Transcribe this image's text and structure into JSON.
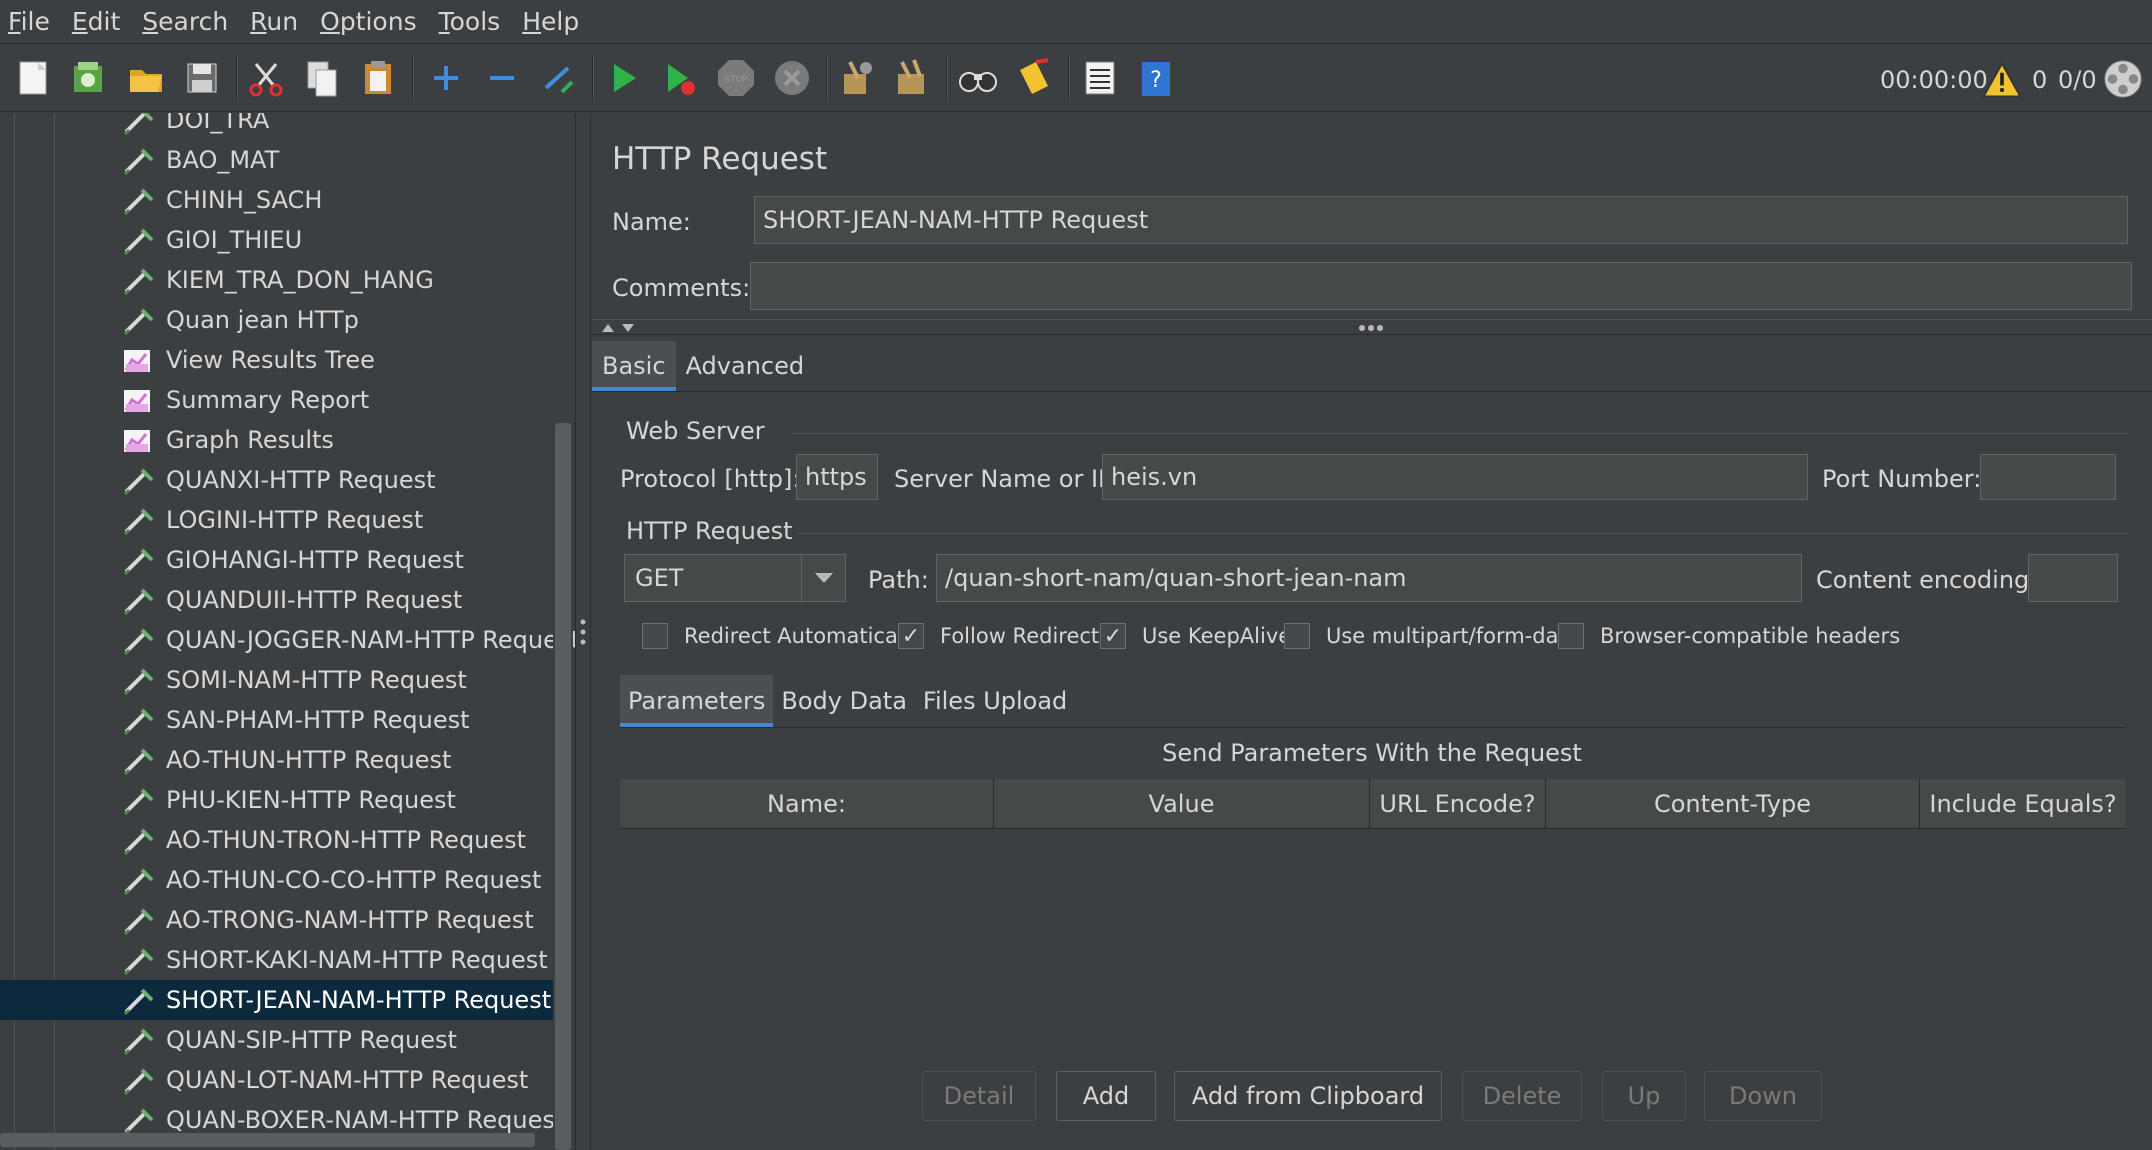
{
  "menu": [
    {
      "label": "File",
      "mnemonic": "F",
      "rest": "ile"
    },
    {
      "label": "Edit",
      "mnemonic": "E",
      "rest": "dit"
    },
    {
      "label": "Search",
      "mnemonic": "S",
      "rest": "earch"
    },
    {
      "label": "Run",
      "mnemonic": "R",
      "rest": "un"
    },
    {
      "label": "Options",
      "mnemonic": "O",
      "rest": "ptions"
    },
    {
      "label": "Tools",
      "mnemonic": "T",
      "rest": "ools"
    },
    {
      "label": "Help",
      "mnemonic": "H",
      "rest": "elp"
    }
  ],
  "toolbar": {
    "icons": [
      "new-icon",
      "templates-icon",
      "open-icon",
      "save-icon",
      "cut-icon",
      "copy-icon",
      "paste-icon",
      "expand-icon",
      "collapse-icon",
      "toggle-icon",
      "start-icon",
      "start-no-pause-icon",
      "stop-icon",
      "shutdown-icon",
      "clear-icon",
      "clear-all-icon",
      "search-icon",
      "reset-search-icon",
      "function-helper-icon",
      "help-icon"
    ],
    "timer": "00:00:00",
    "warning_count": "0",
    "thread_count": "0/0"
  },
  "tree": {
    "items": [
      {
        "label": "DOI_TRA",
        "icon": "sampler-icon"
      },
      {
        "label": "BAO_MAT",
        "icon": "sampler-icon"
      },
      {
        "label": "CHINH_SACH",
        "icon": "sampler-icon"
      },
      {
        "label": "GIOI_THIEU",
        "icon": "sampler-icon"
      },
      {
        "label": "KIEM_TRA_DON_HANG",
        "icon": "sampler-icon"
      },
      {
        "label": "Quan jean HTTp",
        "icon": "sampler-icon"
      },
      {
        "label": "View Results Tree",
        "icon": "listener-icon"
      },
      {
        "label": "Summary Report",
        "icon": "listener-icon"
      },
      {
        "label": "Graph Results",
        "icon": "listener-icon"
      },
      {
        "label": "QUANXI-HTTP Request",
        "icon": "sampler-icon"
      },
      {
        "label": "LOGINI-HTTP Request",
        "icon": "sampler-icon"
      },
      {
        "label": "GIOHANGI-HTTP Request",
        "icon": "sampler-icon"
      },
      {
        "label": "QUANDUII-HTTP Request",
        "icon": "sampler-icon"
      },
      {
        "label": "QUAN-JOGGER-NAM-HTTP Request",
        "icon": "sampler-icon"
      },
      {
        "label": "SOMI-NAM-HTTP Request",
        "icon": "sampler-icon"
      },
      {
        "label": "SAN-PHAM-HTTP Request",
        "icon": "sampler-icon"
      },
      {
        "label": "AO-THUN-HTTP Request",
        "icon": "sampler-icon"
      },
      {
        "label": "PHU-KIEN-HTTP Request",
        "icon": "sampler-icon"
      },
      {
        "label": "AO-THUN-TRON-HTTP Request",
        "icon": "sampler-icon"
      },
      {
        "label": "AO-THUN-CO-CO-HTTP Request",
        "icon": "sampler-icon"
      },
      {
        "label": "AO-TRONG-NAM-HTTP Request",
        "icon": "sampler-icon"
      },
      {
        "label": "SHORT-KAKI-NAM-HTTP Request",
        "icon": "sampler-icon"
      },
      {
        "label": "SHORT-JEAN-NAM-HTTP Request",
        "icon": "sampler-icon",
        "selected": true
      },
      {
        "label": "QUAN-SIP-HTTP Request",
        "icon": "sampler-icon"
      },
      {
        "label": "QUAN-LOT-NAM-HTTP Request",
        "icon": "sampler-icon"
      },
      {
        "label": "QUAN-BOXER-NAM-HTTP Request",
        "icon": "sampler-icon"
      }
    ]
  },
  "panel": {
    "title": "HTTP Request",
    "name_label": "Name:",
    "name_value": "SHORT-JEAN-NAM-HTTP Request",
    "comments_label": "Comments:",
    "comments_value": "",
    "tabs": [
      {
        "label": "Basic",
        "active": true
      },
      {
        "label": "Advanced",
        "active": false
      }
    ],
    "web_server": {
      "title": "Web Server",
      "protocol_label": "Protocol [http]:",
      "protocol_value": "https",
      "server_label": "Server Name or IP",
      "server_value": "heis.vn",
      "port_label": "Port Number:",
      "port_value": ""
    },
    "http_request": {
      "title": "HTTP Request",
      "method": "GET",
      "path_label": "Path:",
      "path_value": "/quan-short-nam/quan-short-jean-nam",
      "encoding_label": "Content encoding:",
      "encoding_value": ""
    },
    "checkboxes": [
      {
        "label": "Redirect Automatically",
        "checked": false
      },
      {
        "label": "Follow Redirects",
        "checked": true
      },
      {
        "label": "Use KeepAlive",
        "checked": true
      },
      {
        "label": "Use multipart/form-data",
        "checked": false
      },
      {
        "label": "Browser-compatible headers",
        "checked": false
      }
    ],
    "subtabs": [
      {
        "label": "Parameters",
        "active": true
      },
      {
        "label": "Body Data",
        "active": false
      },
      {
        "label": "Files Upload",
        "active": false
      }
    ],
    "table_caption": "Send Parameters With the Request",
    "columns": [
      "Name:",
      "Value",
      "URL Encode?",
      "Content-Type",
      "Include Equals?"
    ],
    "buttons": [
      {
        "label": "Detail",
        "enabled": false
      },
      {
        "label": "Add",
        "enabled": true
      },
      {
        "label": "Add from Clipboard",
        "enabled": true
      },
      {
        "label": "Delete",
        "enabled": false
      },
      {
        "label": "Up",
        "enabled": false
      },
      {
        "label": "Down",
        "enabled": false
      }
    ]
  },
  "colors": {
    "background": "#3c3f41",
    "selection": "#0d293e",
    "accent": "#4a88c7",
    "field": "#45494a"
  }
}
